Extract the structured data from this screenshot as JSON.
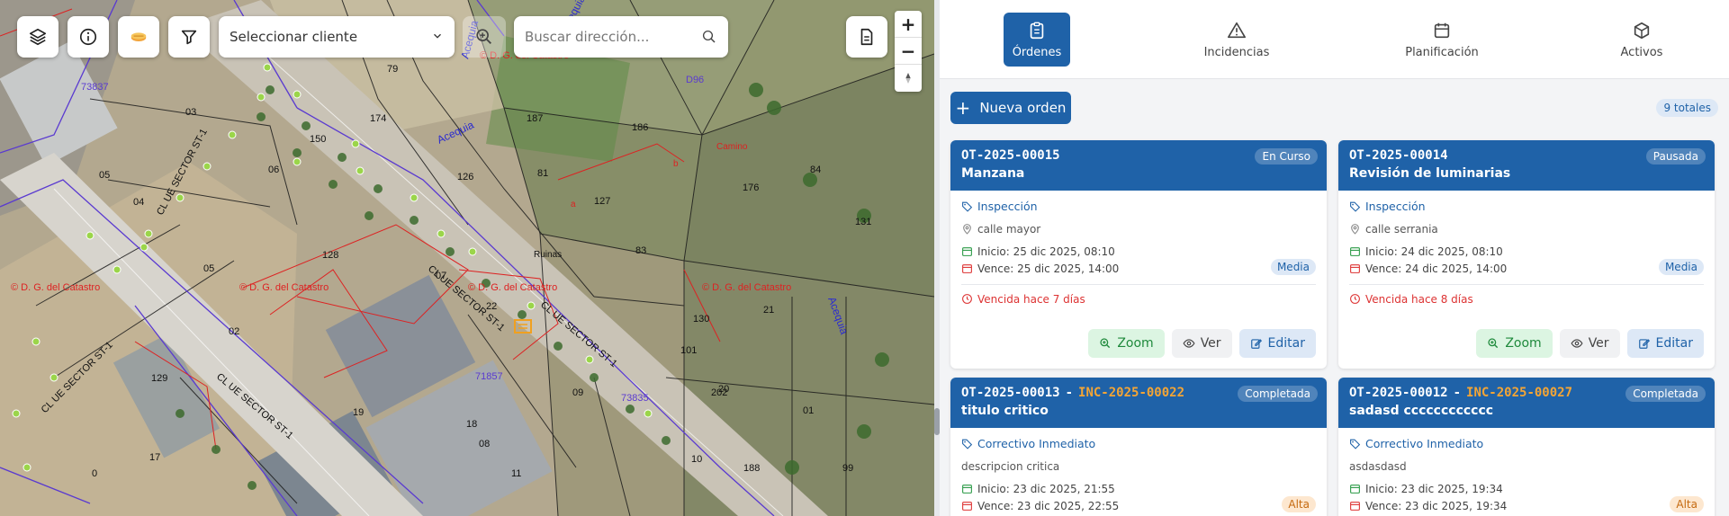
{
  "map": {
    "client_select": "Seleccionar cliente",
    "address_placeholder": "Buscar dirección...",
    "catastro_label": "© D. G. del Catastro",
    "parcels": [
      "79",
      "03",
      "187",
      "186",
      "D96",
      "174",
      "150",
      "05",
      "04",
      "81",
      "126",
      "127",
      "84",
      "83",
      "176",
      "131",
      "06",
      "07",
      "22",
      "05",
      "128",
      "130",
      "21",
      "02",
      "129",
      "101",
      "202",
      "20",
      "19",
      "18",
      "08",
      "09",
      "73835",
      "71857",
      "73837",
      "17",
      "11",
      "10",
      "188",
      "99",
      "01",
      "0"
    ],
    "streets": [
      "Acequia",
      "Acequia",
      "Acequia",
      "Acequia",
      "CL UE SECTOR ST-1",
      "CL UE SECTOR ST-1",
      "CL UE SECTOR ST-1",
      "CL UE SECTOR ST-1",
      "CL UE SECTOR ST-1"
    ],
    "ruins": "Ruinas",
    "label_a": "a",
    "label_b": "b",
    "camino": "Camino"
  },
  "tabs": [
    {
      "label": "Órdenes",
      "icon": "clipboard-icon",
      "active": true
    },
    {
      "label": "Incidencias",
      "icon": "warning-icon",
      "active": false
    },
    {
      "label": "Planificación",
      "icon": "calendar-icon",
      "active": false
    },
    {
      "label": "Activos",
      "icon": "cube-icon",
      "active": false
    }
  ],
  "toolbar": {
    "new_order": "Nueva orden",
    "total": "9 totales"
  },
  "cards": [
    {
      "code": "OT-2025-00015",
      "inc": "",
      "title": "Manzana",
      "status": "En Curso",
      "category": "Inspección",
      "location": "calle mayor",
      "start": "Inicio: 25 dic 2025, 08:10",
      "due": "Vence: 25 dic 2025, 14:00",
      "priority": "Media",
      "priority_class": "media",
      "overdue": "Vencida hace 7 días",
      "zoom": "Zoom",
      "view": "Ver",
      "edit": "Editar"
    },
    {
      "code": "OT-2025-00014",
      "inc": "",
      "title": "Revisión de luminarias",
      "status": "Pausada",
      "category": "Inspección",
      "location": "calle serrania",
      "start": "Inicio: 24 dic 2025, 08:10",
      "due": "Vence: 24 dic 2025, 14:00",
      "priority": "Media",
      "priority_class": "media",
      "overdue": "Vencida hace 8 días",
      "zoom": "Zoom",
      "view": "Ver",
      "edit": "Editar"
    },
    {
      "code": "OT-2025-00013",
      "inc": "INC-2025-00022",
      "title": "titulo critico",
      "status": "Completada",
      "category": "Correctivo Inmediato",
      "location": "descripcion critica",
      "start": "Inicio: 23 dic 2025, 21:55",
      "due": "Vence: 23 dic 2025, 22:55",
      "priority": "Alta",
      "priority_class": "alta",
      "overdue": "",
      "zoom": "",
      "view": "",
      "edit": ""
    },
    {
      "code": "OT-2025-00012",
      "inc": "INC-2025-00027",
      "title": "sadasd cccccccccccc",
      "status": "Completada",
      "category": "Correctivo Inmediato",
      "location": "asdasdasd",
      "start": "Inicio: 23 dic 2025, 19:34",
      "due": "Vence: 23 dic 2025, 19:34",
      "priority": "Alta",
      "priority_class": "alta",
      "overdue": "",
      "zoom": "",
      "view": "",
      "edit": ""
    }
  ]
}
